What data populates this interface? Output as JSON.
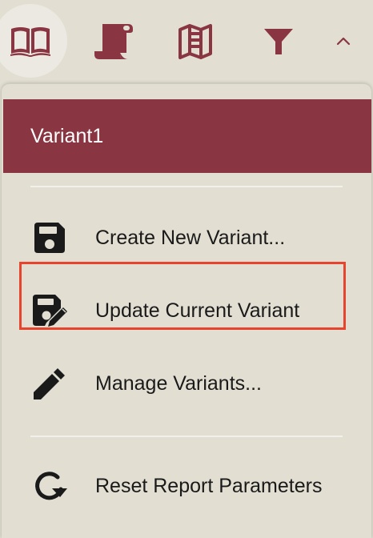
{
  "toolbar": {
    "buttons": [
      {
        "icon": "open-book-icon",
        "active": true
      },
      {
        "icon": "scroll-icon",
        "active": false
      },
      {
        "icon": "map-icon",
        "active": false
      },
      {
        "icon": "filter-icon",
        "active": false
      },
      {
        "icon": "chevron-up-icon",
        "active": false
      }
    ]
  },
  "colors": {
    "accent": "#8a3542",
    "background": "#e2dfd2",
    "highlight_border": "#e8442d",
    "icon_dark": "#1a1a1a"
  },
  "dropdown": {
    "current_variant": "Variant1",
    "items": [
      {
        "label": "Create New Variant...",
        "icon": "save-icon"
      },
      {
        "label": "Update Current Variant",
        "icon": "save-edit-icon"
      },
      {
        "label": "Manage Variants...",
        "icon": "pencil-icon",
        "highlighted": true
      },
      {
        "label": "Reset Report Parameters",
        "icon": "reset-icon"
      }
    ]
  }
}
